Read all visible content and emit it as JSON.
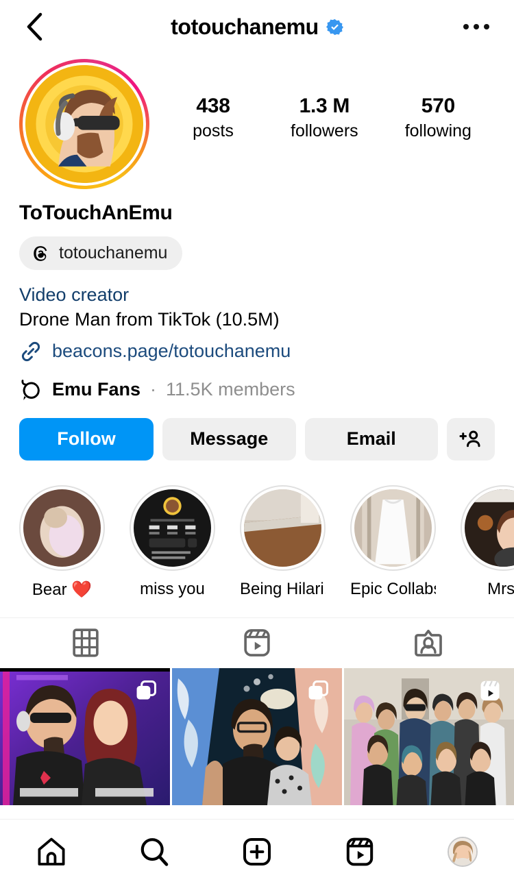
{
  "header": {
    "back_icon": "chevron-left-icon",
    "username": "totouchanemu",
    "verified_icon": "verified-badge-icon",
    "more_icon": "more-options-icon"
  },
  "profile": {
    "avatar_icon": "profile-avatar",
    "display_name": "ToTouchAnEmu",
    "threads_icon": "threads-logo-icon",
    "threads_handle": "totouchanemu",
    "category": "Video creator",
    "bio": "Drone Man from TikTok (10.5M)",
    "link_icon": "link-chain-icon",
    "link": "beacons.page/totouchanemu",
    "channel_icon": "broadcast-channel-icon",
    "channel_name": "Emu Fans",
    "channel_separator": "·",
    "channel_members": "11.5K members"
  },
  "stats": [
    {
      "value": "438",
      "label": "posts"
    },
    {
      "value": "1.3 M",
      "label": "followers"
    },
    {
      "value": "570",
      "label": "following"
    }
  ],
  "actions": {
    "follow": "Follow",
    "message": "Message",
    "email": "Email",
    "add_icon": "add-person-icon"
  },
  "highlights": [
    {
      "label": "Bear ❤️",
      "thumb": "dog-on-carpet-thumb"
    },
    {
      "label": "miss you",
      "thumb": "tiktok-profile-screenshot-thumb"
    },
    {
      "label": "Being Hilari...",
      "thumb": "room-floor-thumb"
    },
    {
      "label": "Epic Collabs",
      "thumb": "white-dress-thumb"
    },
    {
      "label": "Mrs.",
      "thumb": "woman-portrait-thumb"
    }
  ],
  "tabs": [
    {
      "name": "grid",
      "icon": "grid-icon",
      "selected": true
    },
    {
      "name": "reels",
      "icon": "reels-icon",
      "selected": false
    },
    {
      "name": "tagged",
      "icon": "tagged-icon",
      "selected": false
    }
  ],
  "posts": [
    {
      "thumb": "player1-player2-couple",
      "badge": "carousel-icon"
    },
    {
      "thumb": "couple-selfie-colorful-mural",
      "badge": "carousel-icon"
    },
    {
      "thumb": "group-photo-garage",
      "badge": "reels-icon"
    }
  ],
  "bottom_nav": [
    {
      "name": "home",
      "icon": "home-icon"
    },
    {
      "name": "search",
      "icon": "search-icon"
    },
    {
      "name": "create",
      "icon": "create-plus-icon"
    },
    {
      "name": "reels",
      "icon": "reels-icon"
    },
    {
      "name": "profile",
      "icon": "profile-avatar-icon"
    }
  ],
  "colors": {
    "accent_blue": "#0095f6",
    "verified_blue": "#3897f0",
    "category_navy": "#123e6b",
    "link_navy": "#1c4b7d",
    "grey_button": "#efefef",
    "muted_text": "#8e8e8e"
  }
}
